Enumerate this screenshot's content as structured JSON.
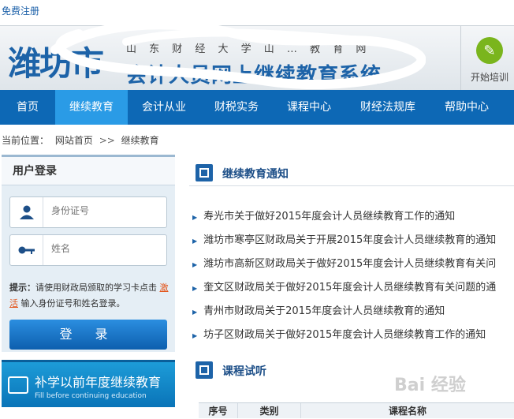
{
  "topbar": {
    "register_link": "免费注册"
  },
  "banner": {
    "city": "潍坊市",
    "university": "山 东 财 经 大 学 山 … 教 育 网",
    "system": "会计人员网上继续教育系统",
    "start_training": "开始培训"
  },
  "nav": {
    "items": [
      "首页",
      "继续教育",
      "会计从业",
      "财税实务",
      "课程中心",
      "财经法规库",
      "帮助中心"
    ],
    "active": "继续教育"
  },
  "breadcrumb": {
    "label": "当前位置：",
    "home": "网站首页",
    "separator": ">>",
    "current": "继续教育"
  },
  "login": {
    "title": "用户登录",
    "id_placeholder": "身份证号",
    "name_placeholder": "姓名",
    "tip_prefix": "提示：",
    "tip_text": "请使用财政局颁取的学习卡点击",
    "activate_link": "激活",
    "tip_suffix": "输入身份证号和姓名登录。",
    "button": "登 录"
  },
  "promo": {
    "title": "补学以前年度继续教育",
    "subtitle": "Fill before continuing education"
  },
  "notices": {
    "title": "继续教育通知",
    "items": [
      "寿光市关于做好2015年度会计人员继续教育工作的通知",
      "潍坊市寒亭区财政局关于开展2015年度会计人员继续教育的通知",
      "潍坊市高新区财政局关于做好2015年度会计人员继续教育有关问",
      "奎文区财政局关于做好2015年度会计人员继续教育有关问题的通",
      "青州市财政局关于2015年度会计人员继续教育的通知",
      "坊子区财政局关于做好2015年度会计人员继续教育工作的通知"
    ]
  },
  "courses": {
    "title": "课程试听",
    "columns": [
      "序号",
      "类别",
      "课程名称"
    ]
  },
  "watermark": "Bai 经验",
  "colors": {
    "nav": "#0d68b5",
    "nav_active": "#2a9be6",
    "brand": "#1d63a8"
  }
}
